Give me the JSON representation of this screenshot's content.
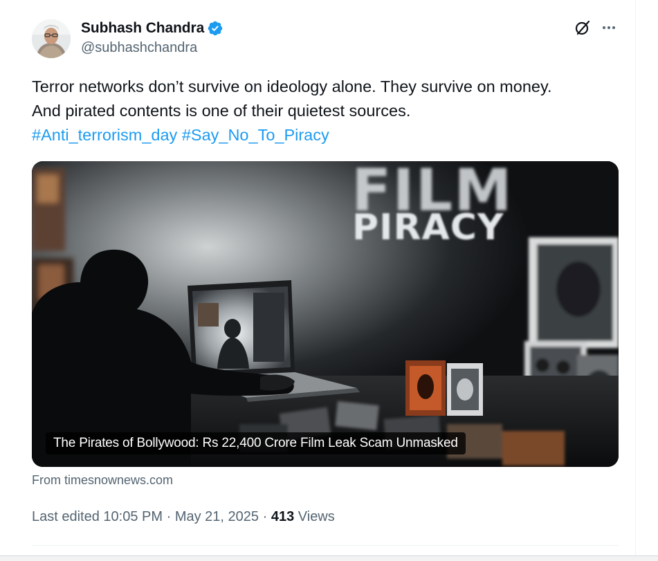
{
  "author": {
    "name": "Subhash Chandra",
    "handle": "@subhashchandra",
    "verified": true,
    "verified_color": "#1d9bf0"
  },
  "header_actions": {
    "grok_icon": "grok-icon",
    "more_icon": "more-icon"
  },
  "tweet": {
    "line1": "Terror networks don’t survive on ideology alone. They survive on money.",
    "line2": "And pirated contents is one of their quietest sources.",
    "hashtags": [
      "#Anti_terrorism_day",
      "#Say_No_To_Piracy"
    ]
  },
  "media": {
    "image_text_film": "FILM",
    "image_text_piracy": "PIRACY",
    "caption": "The Pirates of Bollywood: Rs 22,400 Crore Film Leak Scam Unmasked"
  },
  "source_label": "From timesnownews.com",
  "meta": {
    "edited_prefix": "Last edited",
    "time": "10:05 PM",
    "date": "May 21, 2025",
    "separator": "·",
    "views_count": "413",
    "views_label": "Views"
  },
  "colors": {
    "text_primary": "#0f1419",
    "text_secondary": "#536471",
    "link": "#1d9bf0"
  }
}
